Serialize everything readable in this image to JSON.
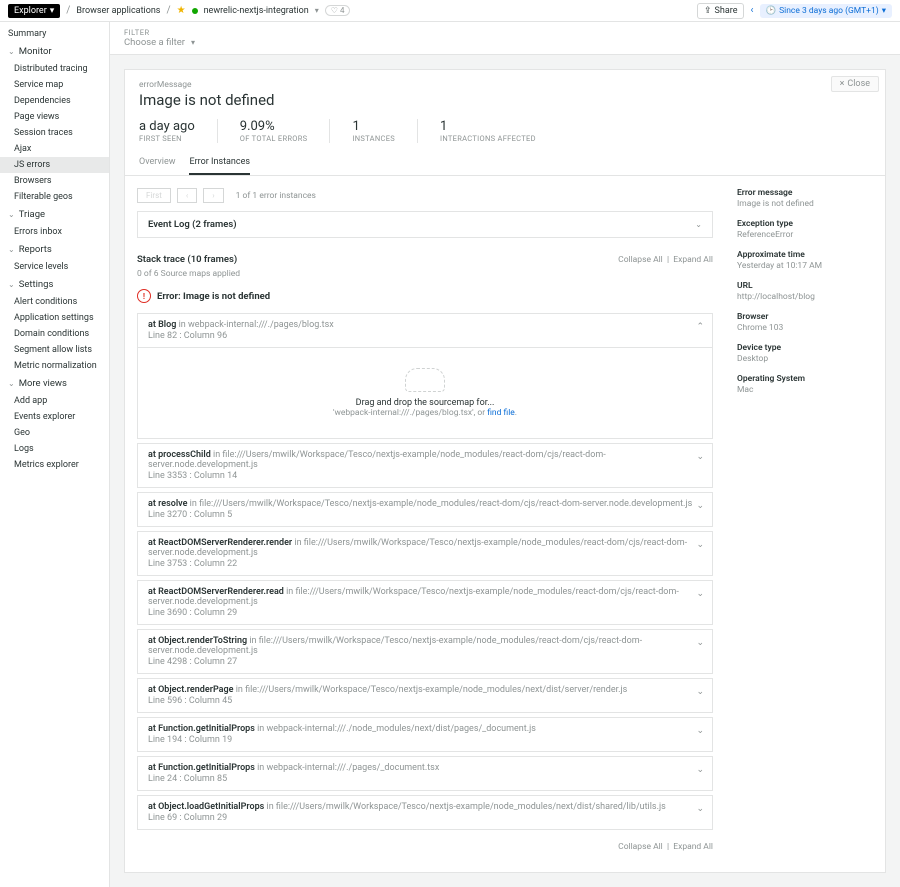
{
  "topbar": {
    "explorer": "Explorer",
    "bc1": "Browser applications",
    "app_name": "newrelic-nextjs-integration",
    "tag_count": "4",
    "share": "Share",
    "time_range": "Since 3 days ago (GMT+1)"
  },
  "sidebar": {
    "summary": "Summary",
    "monitor": "Monitor",
    "monitor_items": [
      "Distributed tracing",
      "Service map",
      "Dependencies",
      "Page views",
      "Session traces",
      "Ajax",
      "JS errors",
      "Browsers",
      "Filterable geos"
    ],
    "triage": "Triage",
    "triage_items": [
      "Errors inbox"
    ],
    "reports": "Reports",
    "reports_items": [
      "Service levels"
    ],
    "settings": "Settings",
    "settings_items": [
      "Alert conditions",
      "Application settings",
      "Domain conditions",
      "Segment allow lists",
      "Metric normalization"
    ],
    "more": "More views",
    "more_items": [
      "Add app",
      "Events explorer",
      "Geo",
      "Logs",
      "Metrics explorer"
    ]
  },
  "filter": {
    "label": "FILTER",
    "value": "Choose a filter"
  },
  "error": {
    "close": "Close",
    "label": "errorMessage",
    "title": "Image is not defined",
    "stats": [
      {
        "val": "a day ago",
        "lbl": "FIRST SEEN"
      },
      {
        "val": "9.09%",
        "lbl": "OF TOTAL ERRORS"
      },
      {
        "val": "1",
        "lbl": "INSTANCES"
      },
      {
        "val": "1",
        "lbl": "INTERACTIONS AFFECTED"
      }
    ],
    "tabs": [
      "Overview",
      "Error Instances"
    ]
  },
  "instances": {
    "pager_first": "First",
    "pager_text": "1 of 1 error instances",
    "event_log": "Event Log (2 frames)",
    "stack_title": "Stack trace (10 frames)",
    "collapse": "Collapse All",
    "expand": "Expand All",
    "maps_applied": "0 of 6 Source maps applied",
    "err_line": "Error: Image is not defined",
    "drop1": "Drag and drop the sourcemap for...",
    "drop2a": "'webpack-internal:///./pages/blog.tsx', or ",
    "drop2b": "find file",
    "frames": [
      {
        "fn": "at Blog",
        "loc": " in webpack-internal:///./pages/blog.tsx",
        "line": "Line 82 : Column 96",
        "expanded": true
      },
      {
        "fn": "at processChild",
        "loc": " in file:///Users/mwilk/Workspace/Tesco/nextjs-example/node_modules/react-dom/cjs/react-dom-server.node.development.js",
        "line": "Line 3353 : Column 14"
      },
      {
        "fn": "at resolve",
        "loc": " in file:///Users/mwilk/Workspace/Tesco/nextjs-example/node_modules/react-dom/cjs/react-dom-server.node.development.js",
        "line": "Line 3270 : Column 5"
      },
      {
        "fn": "at ReactDOMServerRenderer.render",
        "loc": " in file:///Users/mwilk/Workspace/Tesco/nextjs-example/node_modules/react-dom/cjs/react-dom-server.node.development.js",
        "line": "Line 3753 : Column 22"
      },
      {
        "fn": "at ReactDOMServerRenderer.read",
        "loc": " in file:///Users/mwilk/Workspace/Tesco/nextjs-example/node_modules/react-dom/cjs/react-dom-server.node.development.js",
        "line": "Line 3690 : Column 29"
      },
      {
        "fn": "at Object.renderToString",
        "loc": " in file:///Users/mwilk/Workspace/Tesco/nextjs-example/node_modules/react-dom/cjs/react-dom-server.node.development.js",
        "line": "Line 4298 : Column 27"
      },
      {
        "fn": "at Object.renderPage",
        "loc": " in file:///Users/mwilk/Workspace/Tesco/nextjs-example/node_modules/next/dist/server/render.js",
        "line": "Line 596 : Column 45"
      },
      {
        "fn": "at Function.getInitialProps",
        "loc": " in webpack-internal:///./node_modules/next/dist/pages/_document.js",
        "line": "Line 194 : Column 19"
      },
      {
        "fn": "at Function.getInitialProps",
        "loc": " in webpack-internal:///./pages/_document.tsx",
        "line": "Line 24 : Column 85"
      },
      {
        "fn": "at Object.loadGetInitialProps",
        "loc": " in file:///Users/mwilk/Workspace/Tesco/nextjs-example/node_modules/next/dist/shared/lib/utils.js",
        "line": "Line 69 : Column 29"
      }
    ]
  },
  "details": {
    "sections": [
      {
        "lbl": "Error message",
        "val": "Image is not defined"
      },
      {
        "lbl": "Exception type",
        "val": "ReferenceError"
      },
      {
        "lbl": "Approximate time",
        "val": "Yesterday at 10:17 AM"
      },
      {
        "lbl": "URL",
        "val": "http://localhost/blog"
      },
      {
        "lbl": "Browser",
        "val": "Chrome 103"
      },
      {
        "lbl": "Device type",
        "val": "Desktop"
      },
      {
        "lbl": "Operating System",
        "val": "Mac"
      }
    ]
  }
}
